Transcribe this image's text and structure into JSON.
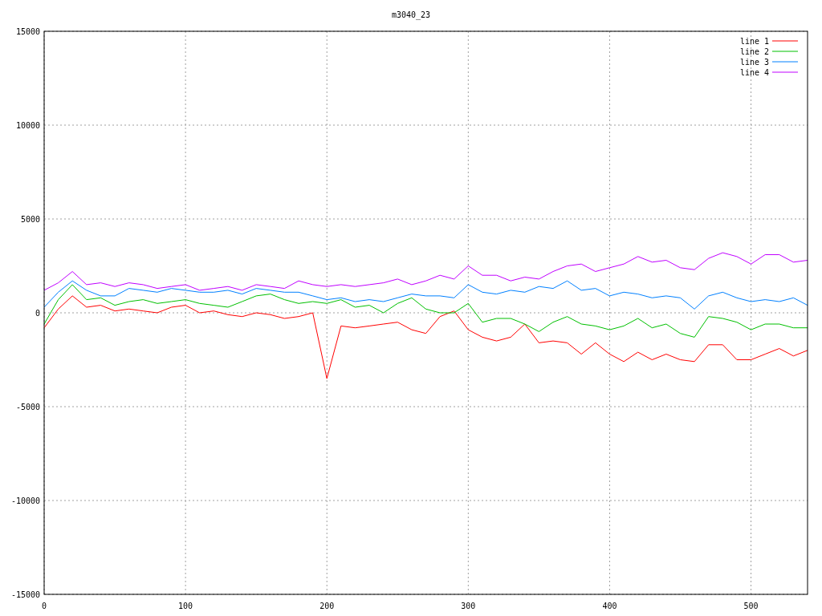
{
  "chart_data": {
    "type": "line",
    "title": "m3040_23",
    "x": [
      0,
      10,
      20,
      30,
      40,
      50,
      60,
      70,
      80,
      90,
      100,
      110,
      120,
      130,
      140,
      150,
      160,
      170,
      180,
      190,
      200,
      210,
      220,
      230,
      240,
      250,
      260,
      270,
      280,
      290,
      300,
      310,
      320,
      330,
      340,
      350,
      360,
      370,
      380,
      390,
      400,
      410,
      420,
      430,
      440,
      450,
      460,
      470,
      480,
      490,
      500,
      510,
      520,
      530,
      540
    ],
    "series": [
      {
        "name": "line 1",
        "color": "#ff0000",
        "values": [
          -800,
          200,
          900,
          300,
          400,
          100,
          200,
          100,
          0,
          300,
          400,
          0,
          100,
          -100,
          -200,
          0,
          -100,
          -300,
          -200,
          0,
          -3500,
          -700,
          -800,
          -700,
          -600,
          -500,
          -900,
          -1100,
          -200,
          100,
          -900,
          -1300,
          -1500,
          -1300,
          -600,
          -1600,
          -1500,
          -1600,
          -2200,
          -1600,
          -2200,
          -2600,
          -2100,
          -2500,
          -2200,
          -2500,
          -2600,
          -1700,
          -1700,
          -2500,
          -2500,
          -2200,
          -1900,
          -2300,
          -2000
        ]
      },
      {
        "name": "line 2",
        "color": "#00c000",
        "values": [
          -600,
          700,
          1500,
          700,
          800,
          400,
          600,
          700,
          500,
          600,
          700,
          500,
          400,
          300,
          600,
          900,
          1000,
          700,
          500,
          600,
          500,
          700,
          300,
          400,
          0,
          500,
          800,
          200,
          0,
          0,
          500,
          -500,
          -300,
          -300,
          -600,
          -1000,
          -500,
          -200,
          -600,
          -700,
          -900,
          -700,
          -300,
          -800,
          -600,
          -1100,
          -1300,
          -200,
          -300,
          -500,
          -900,
          -600,
          -600,
          -800,
          -800
        ]
      },
      {
        "name": "line 3",
        "color": "#0080ff",
        "values": [
          300,
          1100,
          1700,
          1200,
          900,
          900,
          1300,
          1200,
          1100,
          1300,
          1200,
          1100,
          1100,
          1200,
          1000,
          1300,
          1200,
          1100,
          1100,
          900,
          700,
          800,
          600,
          700,
          600,
          800,
          1000,
          900,
          900,
          800,
          1500,
          1100,
          1000,
          1200,
          1100,
          1400,
          1300,
          1700,
          1200,
          1300,
          900,
          1100,
          1000,
          800,
          900,
          800,
          200,
          900,
          1100,
          800,
          600,
          700,
          600,
          800,
          400
        ]
      },
      {
        "name": "line 4",
        "color": "#c000ff",
        "values": [
          1200,
          1600,
          2200,
          1500,
          1600,
          1400,
          1600,
          1500,
          1300,
          1400,
          1500,
          1200,
          1300,
          1400,
          1200,
          1500,
          1400,
          1300,
          1700,
          1500,
          1400,
          1500,
          1400,
          1500,
          1600,
          1800,
          1500,
          1700,
          2000,
          1800,
          2500,
          2000,
          2000,
          1700,
          1900,
          1800,
          2200,
          2500,
          2600,
          2200,
          2400,
          2600,
          3000,
          2700,
          2800,
          2400,
          2300,
          2900,
          3200,
          3000,
          2600,
          3100,
          3100,
          2700,
          2800
        ]
      }
    ],
    "grid": true,
    "legend": true,
    "xlim": [
      0,
      540
    ],
    "ylim": [
      -15000,
      15000
    ],
    "xticks": [
      0,
      100,
      200,
      300,
      400,
      500
    ],
    "yticks": [
      -15000,
      -10000,
      -5000,
      0,
      5000,
      10000,
      15000
    ]
  }
}
